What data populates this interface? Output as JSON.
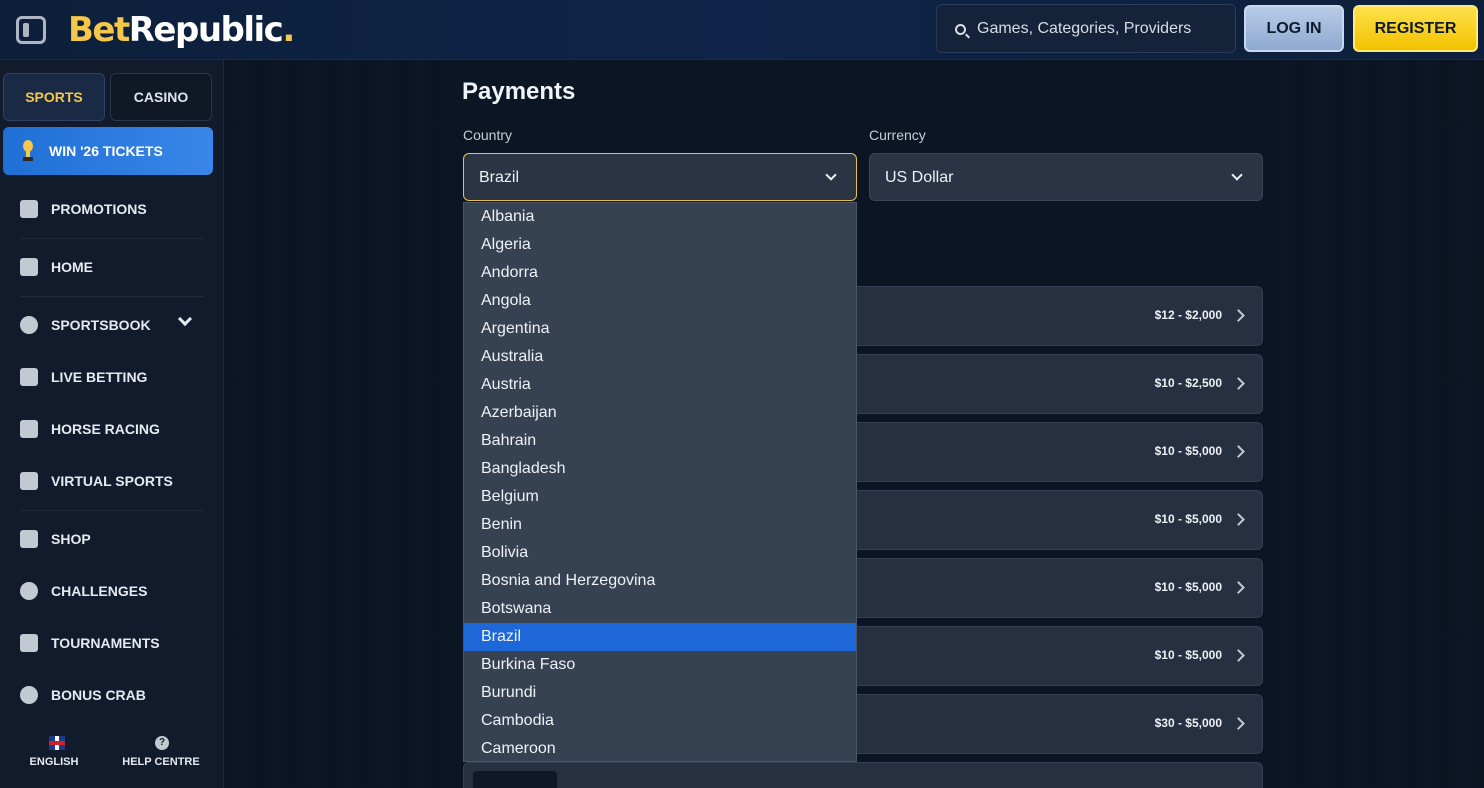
{
  "header": {
    "logo_bet": "Bet",
    "logo_republic": "Republic",
    "logo_dot": ".",
    "search_placeholder": "Games, Categories, Providers",
    "login_label": "LOG IN",
    "register_label": "REGISTER"
  },
  "sidebar": {
    "tabs": [
      {
        "label": "SPORTS"
      },
      {
        "label": "CASINO"
      }
    ],
    "tickets_label": "WIN '26 TICKETS",
    "items": [
      {
        "label": "PROMOTIONS",
        "icon": "gift-icon"
      },
      {
        "label": "HOME",
        "icon": "home-icon"
      },
      {
        "label": "SPORTSBOOK",
        "icon": "soccer-ball-icon"
      },
      {
        "label": "LIVE BETTING",
        "icon": "live-icon"
      },
      {
        "label": "HORSE RACING",
        "icon": "horse-icon"
      },
      {
        "label": "VIRTUAL SPORTS",
        "icon": "virtual-sports-icon"
      },
      {
        "label": "SHOP",
        "icon": "basket-icon"
      },
      {
        "label": "CHALLENGES",
        "icon": "medal-icon"
      },
      {
        "label": "TOURNAMENTS",
        "icon": "podium-icon"
      },
      {
        "label": "BONUS CRAB",
        "icon": "crab-icon"
      }
    ],
    "footer": {
      "language": "ENGLISH",
      "help": "HELP CENTRE",
      "help_glyph": "?"
    }
  },
  "main": {
    "title": "Payments",
    "country_label": "Country",
    "country_value": "Brazil",
    "currency_label": "Currency",
    "currency_value": "US Dollar",
    "payment_ranges": [
      "$12 - $2,000",
      "$10 - $2,500",
      "$10 - $5,000",
      "$10 - $5,000",
      "$10 - $5,000",
      "$10 - $5,000",
      "$30 - $5,000"
    ]
  },
  "dropdown": {
    "options": [
      "Albania",
      "Algeria",
      "Andorra",
      "Angola",
      "Argentina",
      "Australia",
      "Austria",
      "Azerbaijan",
      "Bahrain",
      "Bangladesh",
      "Belgium",
      "Benin",
      "Bolivia",
      "Bosnia and Herzegovina",
      "Botswana",
      "Brazil",
      "Burkina Faso",
      "Burundi",
      "Cambodia",
      "Cameroon"
    ],
    "selected": "Brazil"
  },
  "colors": {
    "accent_yellow": "#f5c84c",
    "selected_blue": "#1d67d8",
    "tickets_blue": "#3a86e8",
    "background": "#0b1320"
  }
}
